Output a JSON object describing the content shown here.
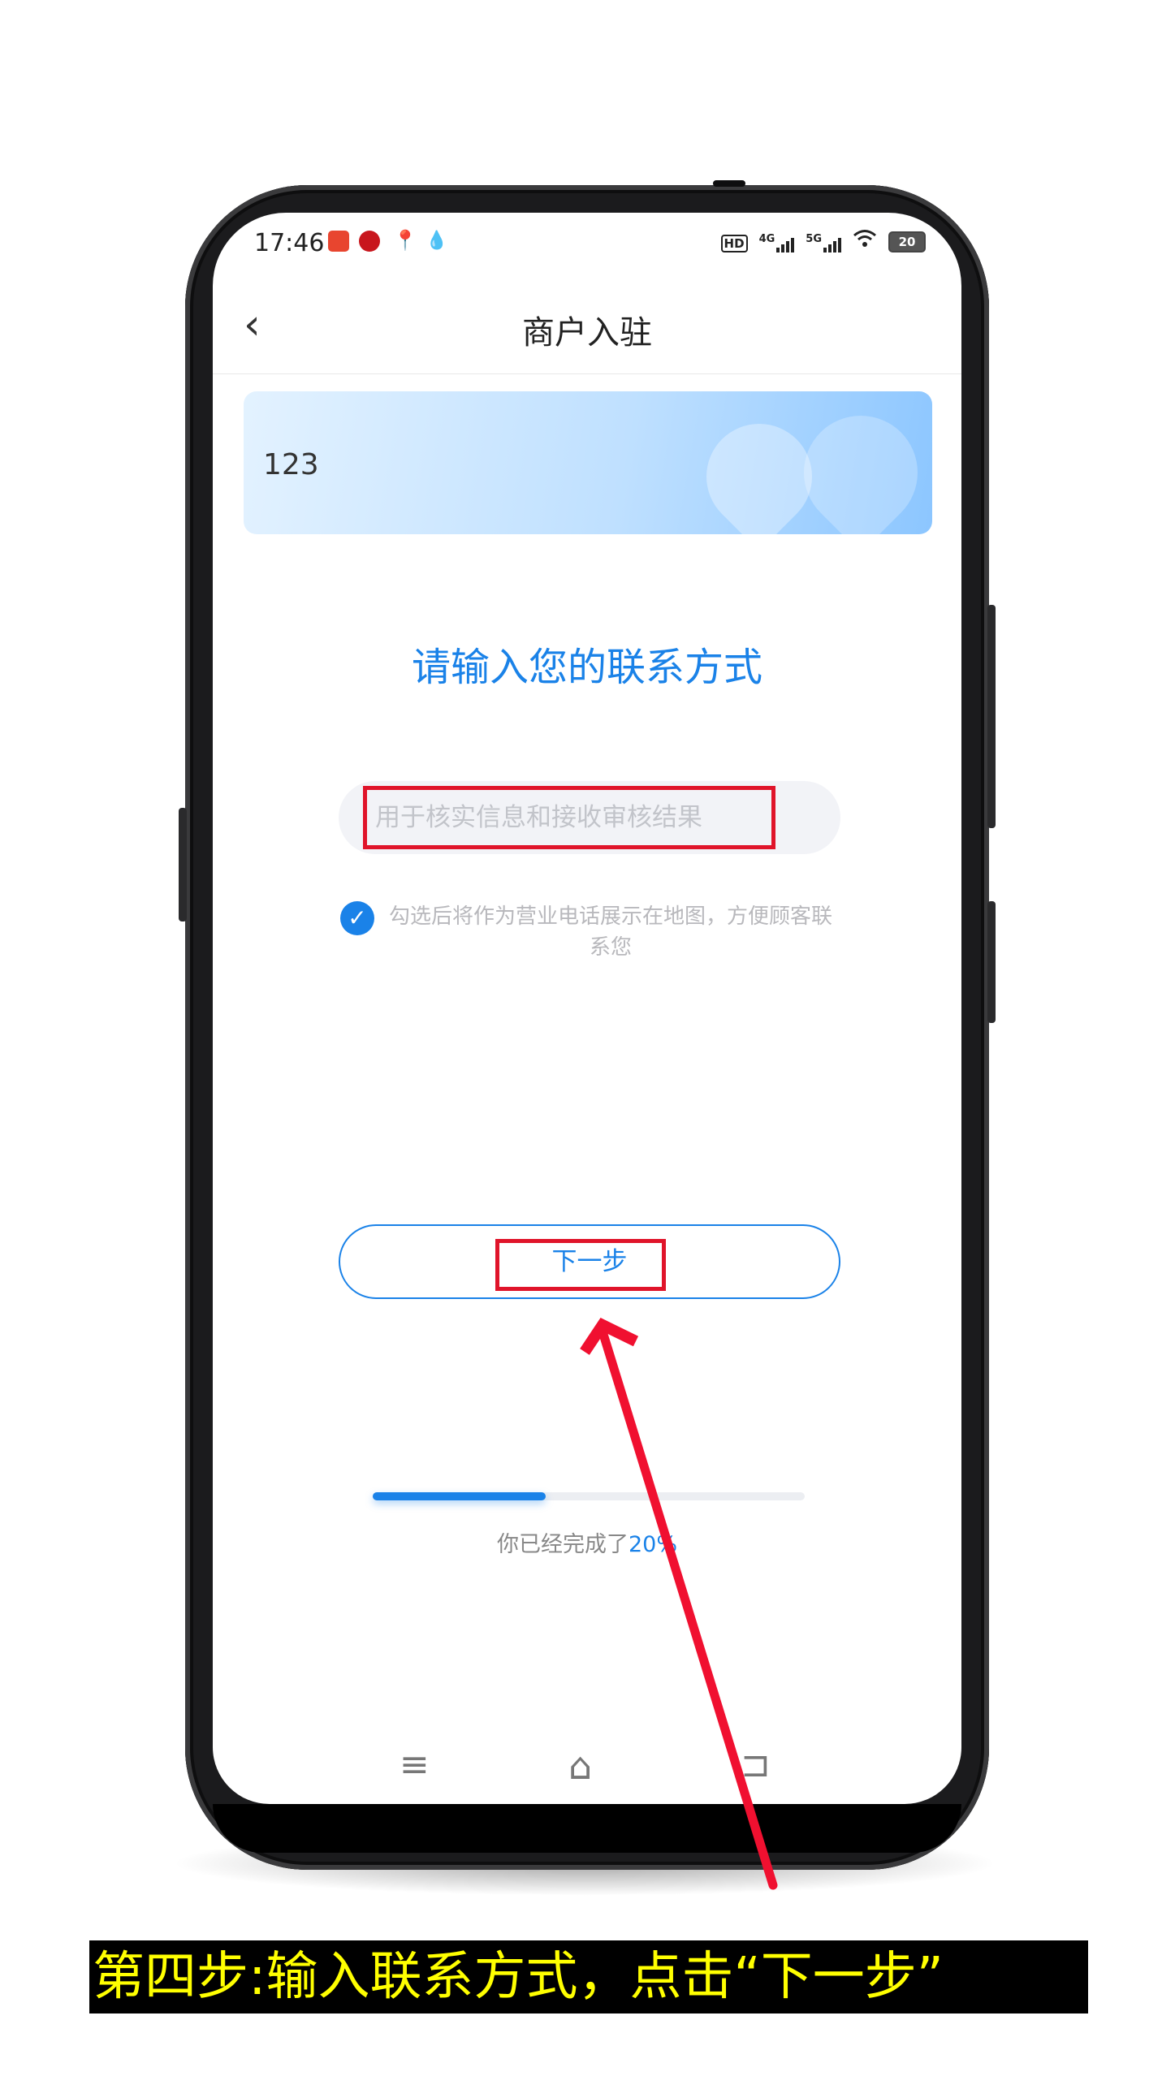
{
  "status_bar": {
    "time": "17:46",
    "hd_label": "HD",
    "net1": "4G",
    "net2": "5G",
    "battery": "20"
  },
  "header": {
    "back_icon": "‹",
    "title": "商户入驻"
  },
  "banner": {
    "text": "123"
  },
  "form": {
    "subtitle": "请输入您的联系方式",
    "phone_placeholder": "用于核实信息和接收审核结果",
    "checkbox_checked": true,
    "checkbox_text": "勾选后将作为营业电话展示在地图，方便顾客联系您",
    "next_label": "下一步"
  },
  "progress": {
    "prefix": "你已经完成了",
    "percent_text": "20%",
    "value": 0.2
  },
  "nav": {
    "menu_icon": "≡",
    "home_icon": "⌂",
    "back_icon": "⊐"
  },
  "annotation": {
    "caption": "第四步:输入联系方式，点击“下一步”",
    "highlight_color": "#e0142a",
    "caption_color": "#ffff00"
  },
  "colors": {
    "accent": "#1a82e8"
  }
}
